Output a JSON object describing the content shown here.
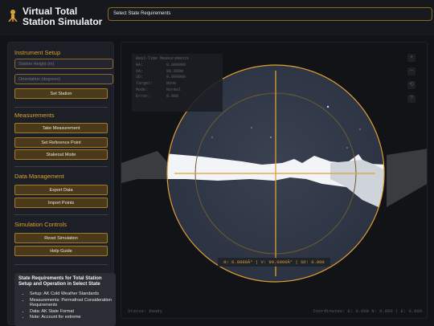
{
  "header": {
    "title": "Virtual Total Station Simulator",
    "state_select": "Select State Requirements"
  },
  "sidebar": {
    "instrument_setup": {
      "title": "Instrument Setup",
      "height_placeholder": "Station Height (m)",
      "orientation_placeholder": "Orientation (degrees)",
      "set_station": "Set Station"
    },
    "measurements": {
      "title": "Measurements",
      "take": "Take Measurement",
      "set_ref": "Set Reference Point",
      "stakeout": "Stakeout Mode"
    },
    "data_management": {
      "title": "Data Management",
      "export": "Export Data",
      "import": "Import Points"
    },
    "simulation_controls": {
      "title": "Simulation Controls",
      "reset": "Reset Simulation",
      "help": "Help Guide"
    },
    "requirements": {
      "title": "State Requirements for Total Station Setup and Operation in Select State",
      "items": [
        "Setup: AK Cold Weather Standards",
        "Measurements: Permafrost Consideration Requirements",
        "Data: AK State Format",
        "Note: Account for extreme"
      ]
    }
  },
  "viewport": {
    "readout": {
      "title": "Real-Time Measurements",
      "rows": [
        {
          "label": "HA:",
          "value": "0.000000"
        },
        {
          "label": "VA:",
          "value": "90.0000"
        },
        {
          "label": "SD:",
          "value": "0.000000"
        },
        {
          "label": "Target:",
          "value": "None"
        },
        {
          "label": "Mode:",
          "value": "Normal"
        },
        {
          "label": "Error:",
          "value": "0.000"
        }
      ]
    },
    "controls": [
      "+",
      "−",
      "⟲",
      "?"
    ],
    "angle_readout": "H: 0.0000Â° | V: 90.0000Â° | SD: 0.000",
    "status": "Status: Ready",
    "coordinates": "Coordinates: E: 0.000 N: 0.000 | E: 0.000"
  }
}
